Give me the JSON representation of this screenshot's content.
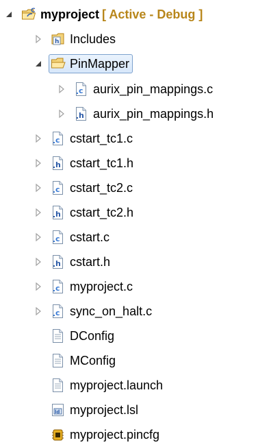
{
  "project": {
    "name": "myproject",
    "status": "[ Active - Debug ]"
  },
  "items": [
    {
      "label": "Includes",
      "icon": "includes-folder-icon"
    },
    {
      "label": "PinMapper",
      "icon": "open-folder-icon"
    },
    {
      "label": "aurix_pin_mappings.c",
      "icon": "c-source-file-icon"
    },
    {
      "label": "aurix_pin_mappings.h",
      "icon": "h-header-file-icon"
    },
    {
      "label": "cstart_tc1.c",
      "icon": "c-source-file-icon"
    },
    {
      "label": "cstart_tc1.h",
      "icon": "h-header-file-icon"
    },
    {
      "label": "cstart_tc2.c",
      "icon": "c-source-file-icon"
    },
    {
      "label": "cstart_tc2.h",
      "icon": "h-header-file-icon"
    },
    {
      "label": "cstart.c",
      "icon": "c-source-file-icon"
    },
    {
      "label": "cstart.h",
      "icon": "h-header-file-icon"
    },
    {
      "label": "myproject.c",
      "icon": "c-source-file-icon"
    },
    {
      "label": "sync_on_halt.c",
      "icon": "c-source-file-icon"
    },
    {
      "label": "DConfig",
      "icon": "text-file-icon"
    },
    {
      "label": "MConfig",
      "icon": "text-file-icon"
    },
    {
      "label": "myproject.launch",
      "icon": "text-file-icon"
    },
    {
      "label": "myproject.lsl",
      "icon": "linker-script-file-icon"
    },
    {
      "label": "myproject.pincfg",
      "icon": "pin-config-file-icon"
    }
  ],
  "colors": {
    "status_text": "#b8861a",
    "selection_border": "#7da2ce",
    "c_letter": "#3a7bd5",
    "h_letter": "#2a5aa8"
  }
}
